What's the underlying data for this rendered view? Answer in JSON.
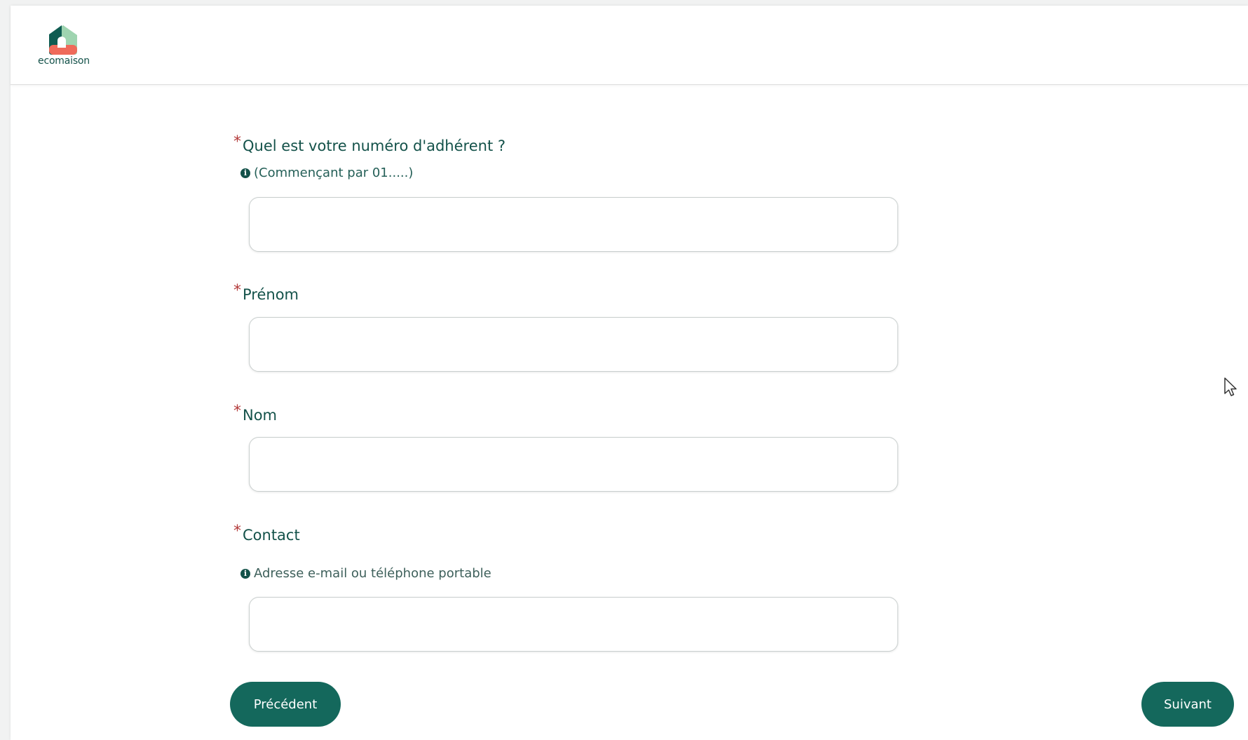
{
  "brand": {
    "name": "ecomaison",
    "colors": {
      "primary": "#14685c",
      "text": "#14524a",
      "required": "#b33a3a",
      "logo_dark": "#0f5c52",
      "logo_light": "#9fd4b0",
      "logo_accent": "#ef6a5a"
    }
  },
  "form": {
    "fields": [
      {
        "label": "Quel est votre numéro d'adhérent ?",
        "required_mark": "*",
        "hint": "(Commençant par 01.....)",
        "hint_icon": "info-icon",
        "value": ""
      },
      {
        "label": "Prénom",
        "required_mark": "*",
        "value": ""
      },
      {
        "label": "Nom",
        "required_mark": "*",
        "value": ""
      },
      {
        "label": "Contact",
        "required_mark": "*",
        "hint": "Adresse e-mail ou téléphone portable",
        "hint_icon": "info-icon",
        "value": ""
      }
    ]
  },
  "nav": {
    "previous_label": "Précédent",
    "next_label": "Suivant"
  }
}
